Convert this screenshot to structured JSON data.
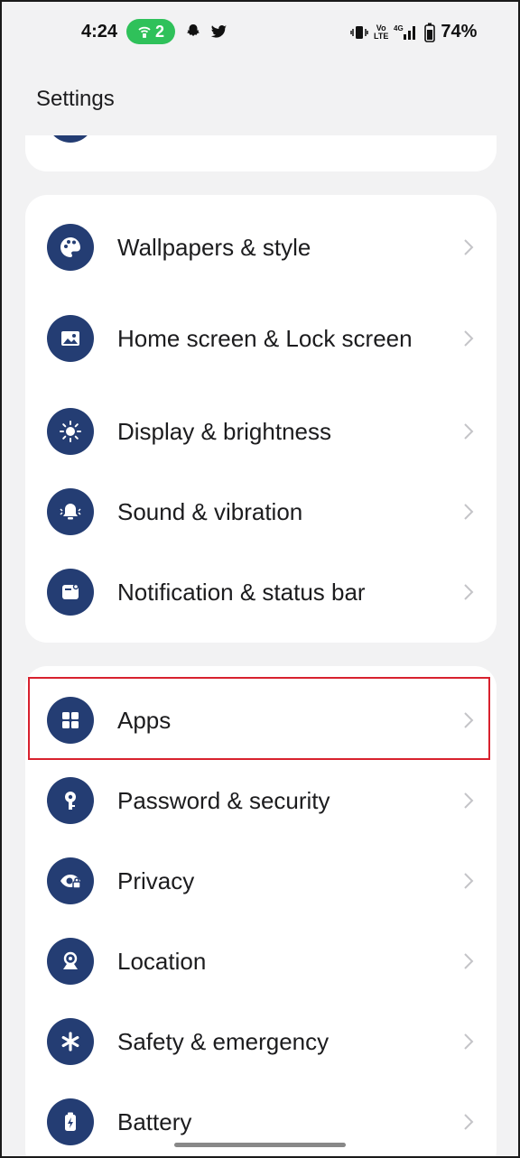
{
  "status_bar": {
    "time": "4:24",
    "hotspot_count": "2",
    "volte": "Vo\nLTE",
    "network": "4G",
    "battery_percent": "74%"
  },
  "header": {
    "title": "Settings"
  },
  "groups": [
    {
      "items": [
        {
          "label": "Wallpapers & style",
          "icon": "palette-icon"
        },
        {
          "label": "Home screen & Lock screen",
          "icon": "image-icon"
        },
        {
          "label": "Display & brightness",
          "icon": "brightness-icon"
        },
        {
          "label": "Sound & vibration",
          "icon": "bell-icon"
        },
        {
          "label": "Notification & status bar",
          "icon": "notification-icon"
        }
      ]
    },
    {
      "items": [
        {
          "label": "Apps",
          "icon": "apps-grid-icon"
        },
        {
          "label": "Password & security",
          "icon": "key-icon"
        },
        {
          "label": "Privacy",
          "icon": "privacy-eye-icon"
        },
        {
          "label": "Location",
          "icon": "location-icon"
        },
        {
          "label": "Safety & emergency",
          "icon": "asterisk-icon"
        },
        {
          "label": "Battery",
          "icon": "battery-icon"
        }
      ]
    }
  ],
  "colors": {
    "icon_bg": "#243d73",
    "highlight": "#d8212e",
    "hotspot_pill": "#2fc15a"
  }
}
